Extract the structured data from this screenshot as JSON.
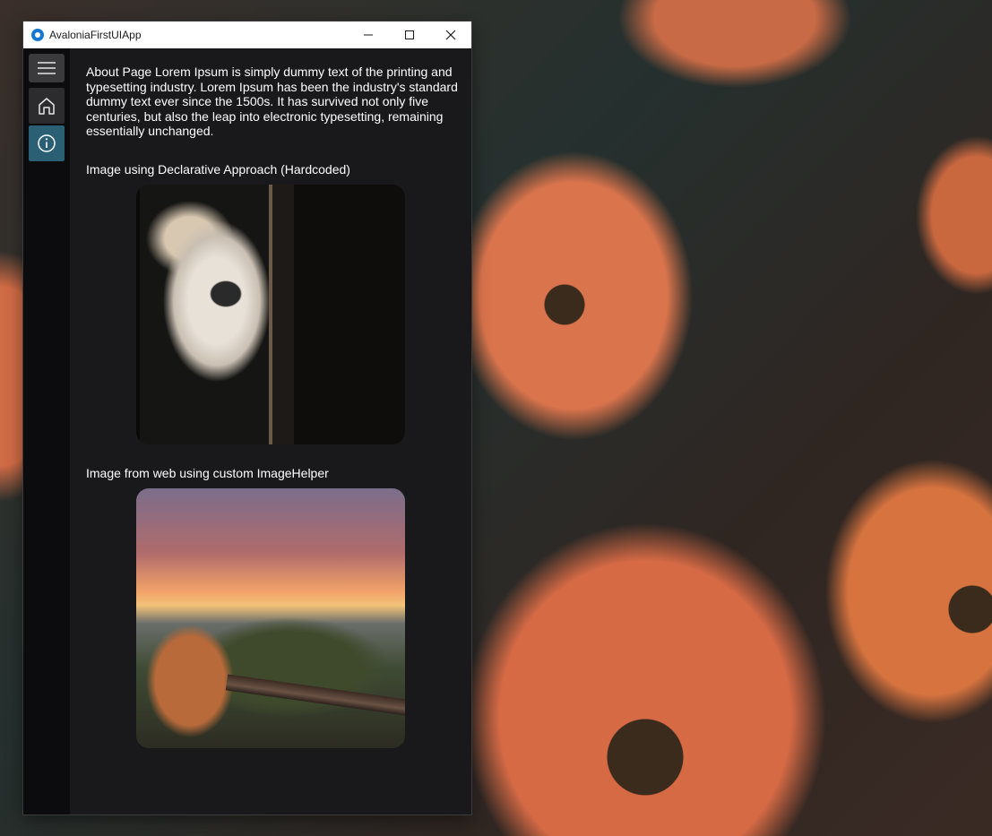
{
  "window": {
    "title": "AvaloniaFirstUIApp"
  },
  "sidebar": {
    "items": [
      {
        "icon": "hamburger-icon"
      },
      {
        "icon": "home-icon"
      },
      {
        "icon": "info-icon"
      }
    ],
    "selected": "info"
  },
  "content": {
    "about_text": "About Page Lorem Ipsum is simply dummy text of the printing and typesetting industry. Lorem Ipsum has been the industry's standard dummy text ever since the 1500s. It has survived not only five centuries, but also the leap into electronic typesetting, remaining essentially unchanged.",
    "heading_declarative": "Image using Declarative Approach (Hardcoded)",
    "heading_web": "Image from web using custom ImageHelper"
  },
  "colors": {
    "accent": "#2a5f74",
    "background": "#19191b",
    "sidebar": "#0c0c0e"
  }
}
